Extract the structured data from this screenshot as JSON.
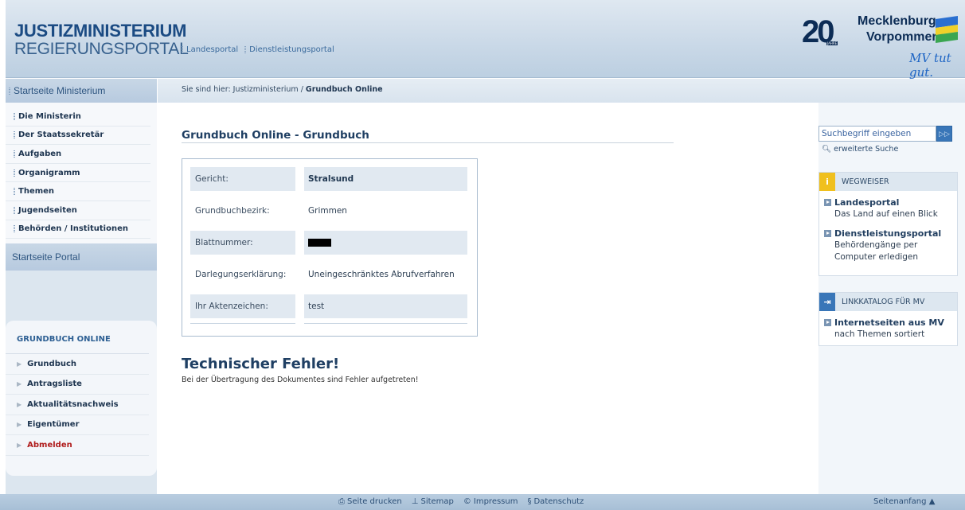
{
  "header": {
    "brand_top": "JUSTIZMINISTERIUM",
    "brand_bottom": "REGIERUNGSPORTAL",
    "topnav": [
      "Landesportal",
      "Dienstleistungsportal"
    ],
    "logo": {
      "number": "20",
      "jahre": "JAHRE",
      "line1": "Mecklenburg",
      "line2": "Vorpommern",
      "slogan": "MV tut gut."
    }
  },
  "sidebar": {
    "head": "Startseite Ministerium",
    "items": [
      "Die Ministerin",
      "Der Staatssekretär",
      "Aufgaben",
      "Organigramm",
      "Themen",
      "Jugendseiten",
      "Behörden / Institutionen"
    ],
    "portal_link": "Startseite Portal",
    "grundbuch": {
      "title": "GRUNDBUCH ONLINE",
      "items": [
        "Grundbuch",
        "Antragsliste",
        "Aktualitätsnachweis",
        "Eigentümer",
        "Abmelden"
      ]
    }
  },
  "breadcrumb": {
    "prefix": "Sie sind hier: Justizministerium / ",
    "current": "Grundbuch Online"
  },
  "main": {
    "title": "Grundbuch Online - Grundbuch",
    "rows": [
      {
        "label": "Gericht:",
        "value": "Stralsund"
      },
      {
        "label": "Grundbuchbezirk:",
        "value": "Grimmen"
      },
      {
        "label": "Blattnummer:",
        "value": ""
      },
      {
        "label": "Darlegungserklärung:",
        "value": "Uneingeschränktes Abrufverfahren"
      },
      {
        "label": "Ihr Aktenzeichen:",
        "value": "test"
      }
    ],
    "error_title": "Technischer Fehler!",
    "error_text": "Bei der Übertragung des Dokumentes sind Fehler aufgetreten!"
  },
  "right": {
    "search_placeholder": "Suchbegriff eingeben",
    "advanced_search": "erweiterte Suche",
    "wegweiser": {
      "title": "WEGWEISER",
      "entries": [
        {
          "title": "Landesportal",
          "sub": "Das Land auf einen Blick"
        },
        {
          "title": "Dienstleistungsportal",
          "sub": "Behördengänge per Computer erledigen"
        }
      ]
    },
    "linkkatalog": {
      "title": "LINKKATALOG FÜR MV",
      "entries": [
        {
          "title": "Internetseiten aus MV",
          "sub": "nach Themen sortiert"
        }
      ]
    }
  },
  "footer": {
    "links": [
      "Seite drucken",
      "Sitemap",
      "Impressum",
      "Datenschutz"
    ],
    "to_top": "Seitenanfang"
  },
  "colors": {
    "accent_blue": "#3976b8",
    "wegweiser_icon": "#f0c01e",
    "error_red": "#b01d1d"
  }
}
